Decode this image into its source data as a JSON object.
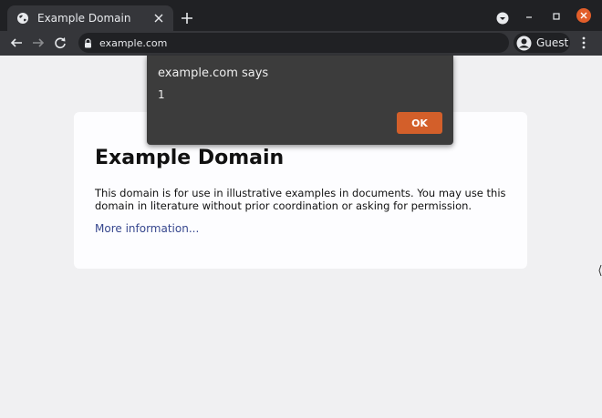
{
  "tab": {
    "title": "Example Domain",
    "favicon": "globe-icon"
  },
  "toolbar": {
    "url": "example.com",
    "profile_label": "Guest"
  },
  "page": {
    "heading": "Example Domain",
    "body": "This domain is for use in illustrative examples in documents. You may use this domain in literature without prior coordination or asking for permission.",
    "link": "More information..."
  },
  "dialog": {
    "title": "example.com says",
    "message": "1",
    "ok_label": "OK"
  },
  "colors": {
    "chrome_dark": "#202124",
    "toolbar": "#35363a",
    "page_bg": "#f0f0f2",
    "card_bg": "#fdfdff",
    "link": "#38488f",
    "dialog_bg": "#3c3c3c",
    "ok_button": "#d35f2a",
    "window_close": "#e25e2a"
  }
}
